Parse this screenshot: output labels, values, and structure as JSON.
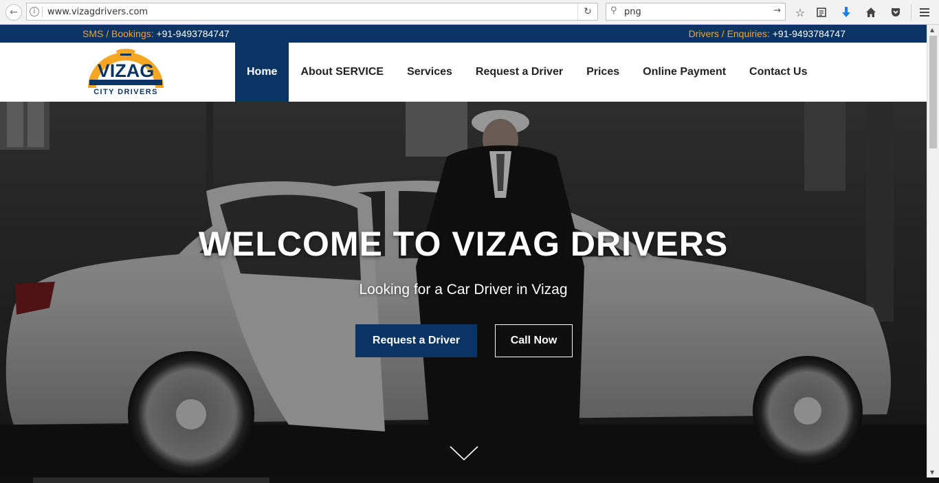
{
  "browser": {
    "url": "www.vizagdrivers.com",
    "search_query": "png",
    "back_icon": "arrow-left-icon",
    "reload_icon": "reload-icon"
  },
  "topbar": {
    "sms_label": "SMS / Bookings:",
    "sms_number": "+91-9493784747",
    "enquiry_label": "Drivers / Enquiries:",
    "enquiry_number": "+91-9493784747"
  },
  "logo": {
    "title": "VIZAG",
    "subtitle": "CITY DRIVERS"
  },
  "nav": {
    "items": [
      {
        "label": "Home",
        "active": true
      },
      {
        "label": "About SERVICE",
        "active": false
      },
      {
        "label": "Services",
        "active": false
      },
      {
        "label": "Request a Driver",
        "active": false
      },
      {
        "label": "Prices",
        "active": false
      },
      {
        "label": "Online Payment",
        "active": false
      },
      {
        "label": "Contact Us",
        "active": false
      }
    ]
  },
  "hero": {
    "title": "WELCOME TO VIZAG DRIVERS",
    "subtitle": "Looking for a Car Driver in Vizag",
    "primary_button": "Request a Driver",
    "secondary_button": "Call Now"
  },
  "colors": {
    "brand_navy": "#0a3464",
    "accent_orange": "#f5a623"
  }
}
